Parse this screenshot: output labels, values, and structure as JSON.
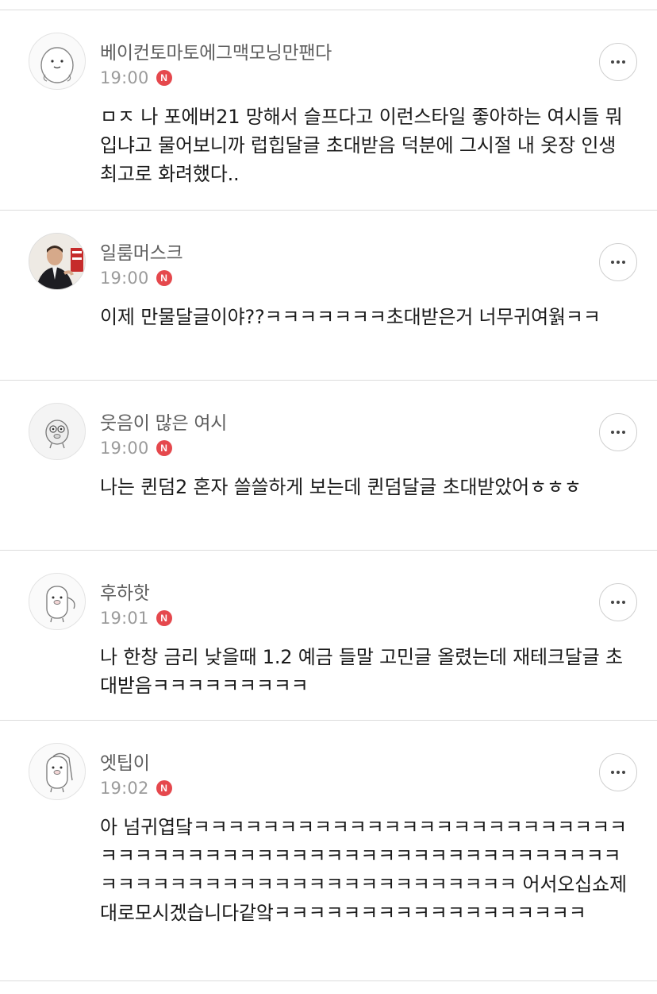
{
  "comments": [
    {
      "username": "베이컨토마토에그맥모닝만팬다",
      "time": "19:00",
      "badge": "N",
      "avatar_icon": "white-blob-character-icon",
      "text": "ㅁㅈ 나 포에버21 망해서 슬프다고 이런스타일 좋아하는 여시들 뭐입냐고 물어보니까 럽힙달글 초대받음 덕분에 그시절 내 옷장 인생최고로 화려했다.."
    },
    {
      "username": "일룸머스크",
      "time": "19:00",
      "badge": "N",
      "avatar_icon": "man-in-suit-photo-icon",
      "text": "이제 만물달글이야??ㅋㅋㅋㅋㅋㅋㅋ초대받은거 너무귀여웕ㅋㅋ"
    },
    {
      "username": "웃음이 많은 여시",
      "time": "19:00",
      "badge": "N",
      "avatar_icon": "grey-goggles-character-icon",
      "text": "나는 퀸덤2 혼자 쓸쓸하게 보는데 퀸덤달글 초대받았어ㅎㅎㅎ"
    },
    {
      "username": "후하핫",
      "time": "19:01",
      "badge": "N",
      "avatar_icon": "pig-character-icon",
      "text": "나 한창 금리 낮을때 1.2 예금 들말 고민글 올렸는데 재테크달글 초대받음ㅋㅋㅋㅋㅋㅋㅋㅋㅋ"
    },
    {
      "username": "엣팁이",
      "time": "19:02",
      "badge": "N",
      "avatar_icon": "pig-character-icon",
      "text": "아 넘귀엽닼ㅋㅋㅋㅋㅋㅋㅋㅋㅋㅋㅋㅋㅋㅋㅋㅋㅋㅋㅋㅋㅋㅋㅋㅋㅋㅋㅋㅋㅋㅋㅋㅋㅋㅋㅋㅋㅋㅋㅋㅋㅋㅋㅋㅋㅋㅋㅋㅋㅋㅋㅋㅋㅋㅋㅋㅋㅋㅋㅋㅋㅋㅋㅋㅋㅋㅋㅋㅋㅋㅋㅋㅋㅋㅋㅋㅋㅋㅋㅋ 어서오십쇼제대로모시겠습니다같앜ㅋㅋㅋㅋㅋㅋㅋㅋㅋㅋㅋㅋㅋㅋㅋㅋㅋㅋ"
    }
  ],
  "more_icon": "more-dots-icon",
  "colors": {
    "badge": "#e5484d",
    "divider": "#dcdcdc",
    "meta": "#9b9b9b"
  }
}
